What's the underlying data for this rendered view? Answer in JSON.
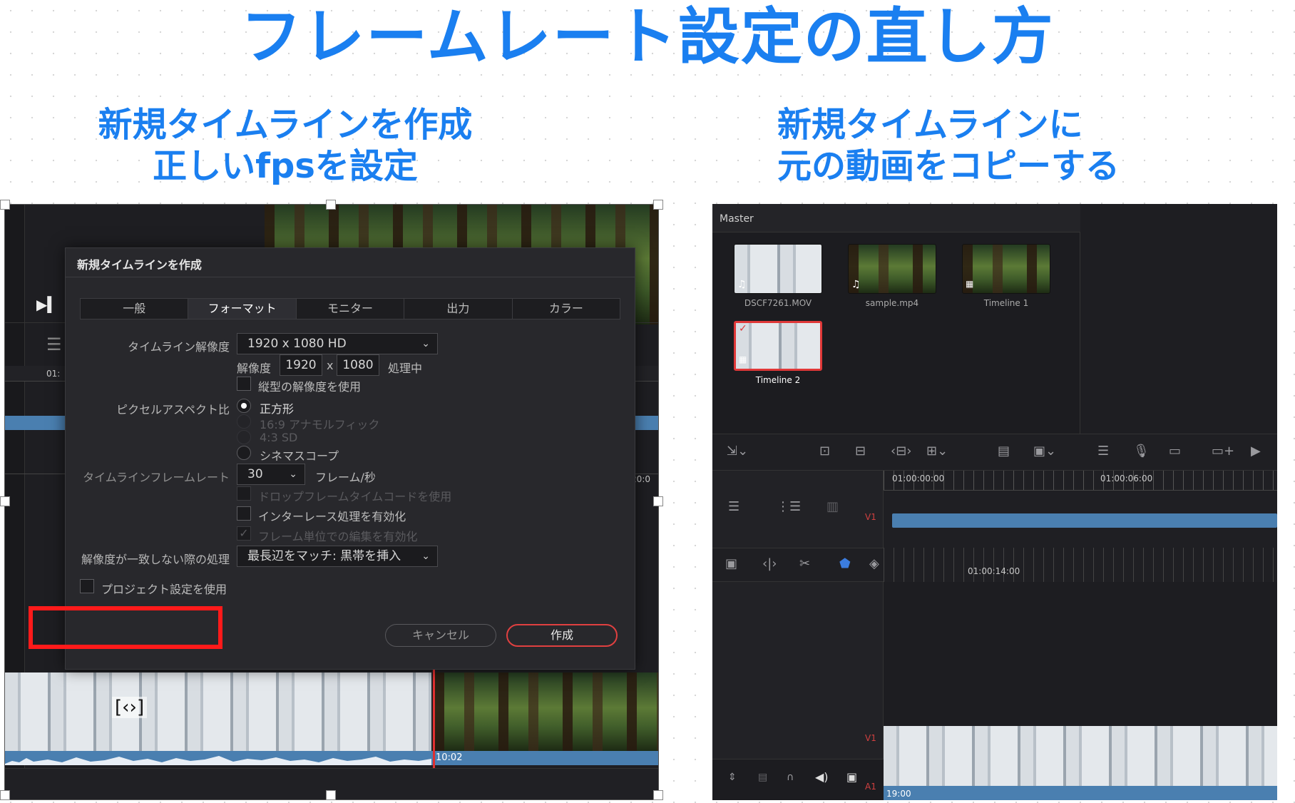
{
  "main_title": "フレームレート設定の直し方",
  "caption_left": {
    "line1": "新規タイムラインを作成",
    "line2": "正しいfpsを設定"
  },
  "caption_right": {
    "line1": "新規タイムラインに",
    "line2": "元の動画をコピーする"
  },
  "dialog": {
    "title": "新規タイムラインを作成",
    "tabs": [
      "一般",
      "フォーマット",
      "モニター",
      "出力",
      "カラー"
    ],
    "active_tab": "フォーマット",
    "timeline_resolution": {
      "label": "タイムライン解像度",
      "value": "1920 x 1080 HD"
    },
    "resolution": {
      "label": "解像度",
      "width": "1920",
      "x": "x",
      "height": "1080",
      "processing": "処理中"
    },
    "vertical_resolution": "縦型の解像度を使用",
    "pixel_aspect": {
      "label": "ピクセルアスペクト比",
      "options": [
        "正方形",
        "16:9 アナモルフィック",
        "4:3 SD",
        "シネマスコープ"
      ],
      "selected": "正方形"
    },
    "frame_rate": {
      "label": "タイムラインフレームレート",
      "value": "30",
      "unit": "フレーム/秒"
    },
    "drop_frame": "ドロップフレームタイムコードを使用",
    "interlace": "インターレース処理を有効化",
    "frame_edit": "フレーム単位での編集を有効化",
    "mismatch": {
      "label": "解像度が一致しない際の処理",
      "value": "最長辺をマッチ: 黒帯を挿入"
    },
    "use_project": "プロジェクト設定を使用",
    "cancel": "キャンセル",
    "create": "作成"
  },
  "left_timeline": {
    "timecode_left": "01:",
    "timecode_right": ":20:0",
    "clip_time": "10:02"
  },
  "media_pool": {
    "bin": "Master",
    "items": [
      {
        "name": "DSCF7261.MOV",
        "kind": "video"
      },
      {
        "name": "sample.mp4",
        "kind": "video"
      },
      {
        "name": "Timeline 1",
        "kind": "timeline"
      },
      {
        "name": "Timeline 2",
        "kind": "timeline",
        "selected": true
      }
    ]
  },
  "right_timeline": {
    "ruler": [
      "01:00:00:00",
      "01:00:06:00"
    ],
    "ruler2": "01:00:14:00",
    "track_v1": "V1",
    "track_v1_lower": "V1",
    "track_a1": "A1",
    "bottom_time": "19:00"
  },
  "colors": {
    "accent_blue": "#1a7ff0",
    "highlight_red": "#ff1a1a",
    "clip_blue": "#4a7fb0"
  }
}
